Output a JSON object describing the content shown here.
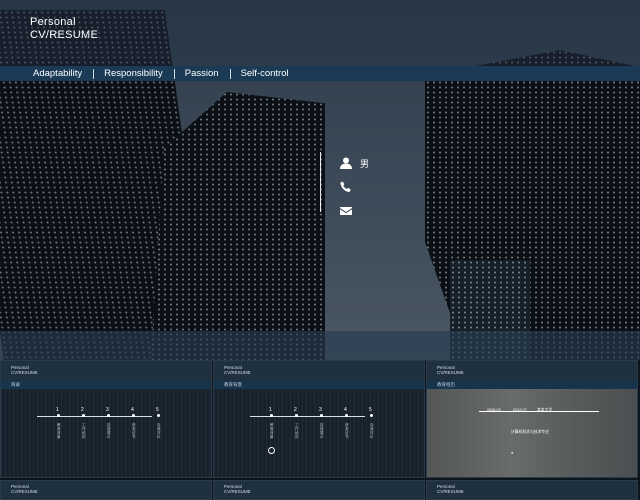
{
  "brand": {
    "line1": "Personal",
    "line2": "CV/RESUME"
  },
  "nav": [
    "Adaptability",
    "Responsibility",
    "Passion",
    "Self-control"
  ],
  "contact": {
    "gender": "男",
    "icons": [
      "person-icon",
      "phone-icon",
      "mail-icon"
    ]
  },
  "thumbs": [
    {
      "title1": "Personal",
      "title2": "CV/RESUME",
      "sub": "目录",
      "timeline": [
        {
          "num": "1",
          "text": "教育背景"
        },
        {
          "num": "2",
          "text": "工作经历"
        },
        {
          "num": "3",
          "text": "技能展示"
        },
        {
          "num": "4",
          "text": "获奖证书"
        },
        {
          "num": "5",
          "text": "自我评价"
        }
      ]
    },
    {
      "title1": "Personal",
      "title2": "CV/RESUME",
      "sub": "教育背景",
      "timeline": [
        {
          "num": "1",
          "text": "教育背景"
        },
        {
          "num": "2",
          "text": "工作经历"
        },
        {
          "num": "3",
          "text": "技能展示"
        },
        {
          "num": "4",
          "text": "获奖证书"
        },
        {
          "num": "5",
          "text": "自我评价"
        }
      ]
    },
    {
      "title1": "Personal",
      "title2": "CV/RESUME",
      "sub": "教育经历",
      "dates": [
        "2008.09",
        "2012.07"
      ],
      "school": "某某大学",
      "desc": "计算机科学与技术专业",
      "bullet": "●"
    }
  ],
  "bottom_thumbs": [
    {
      "title1": "Personal",
      "title2": "CV/RESUME"
    },
    {
      "title1": "Personal",
      "title2": "CV/RESUME"
    },
    {
      "title1": "Personal",
      "title2": "CV/RESUME"
    }
  ],
  "colors": {
    "nav_bg": "#1b3a55",
    "thumb_bg": "#16212c",
    "accent": "#1f3140"
  }
}
